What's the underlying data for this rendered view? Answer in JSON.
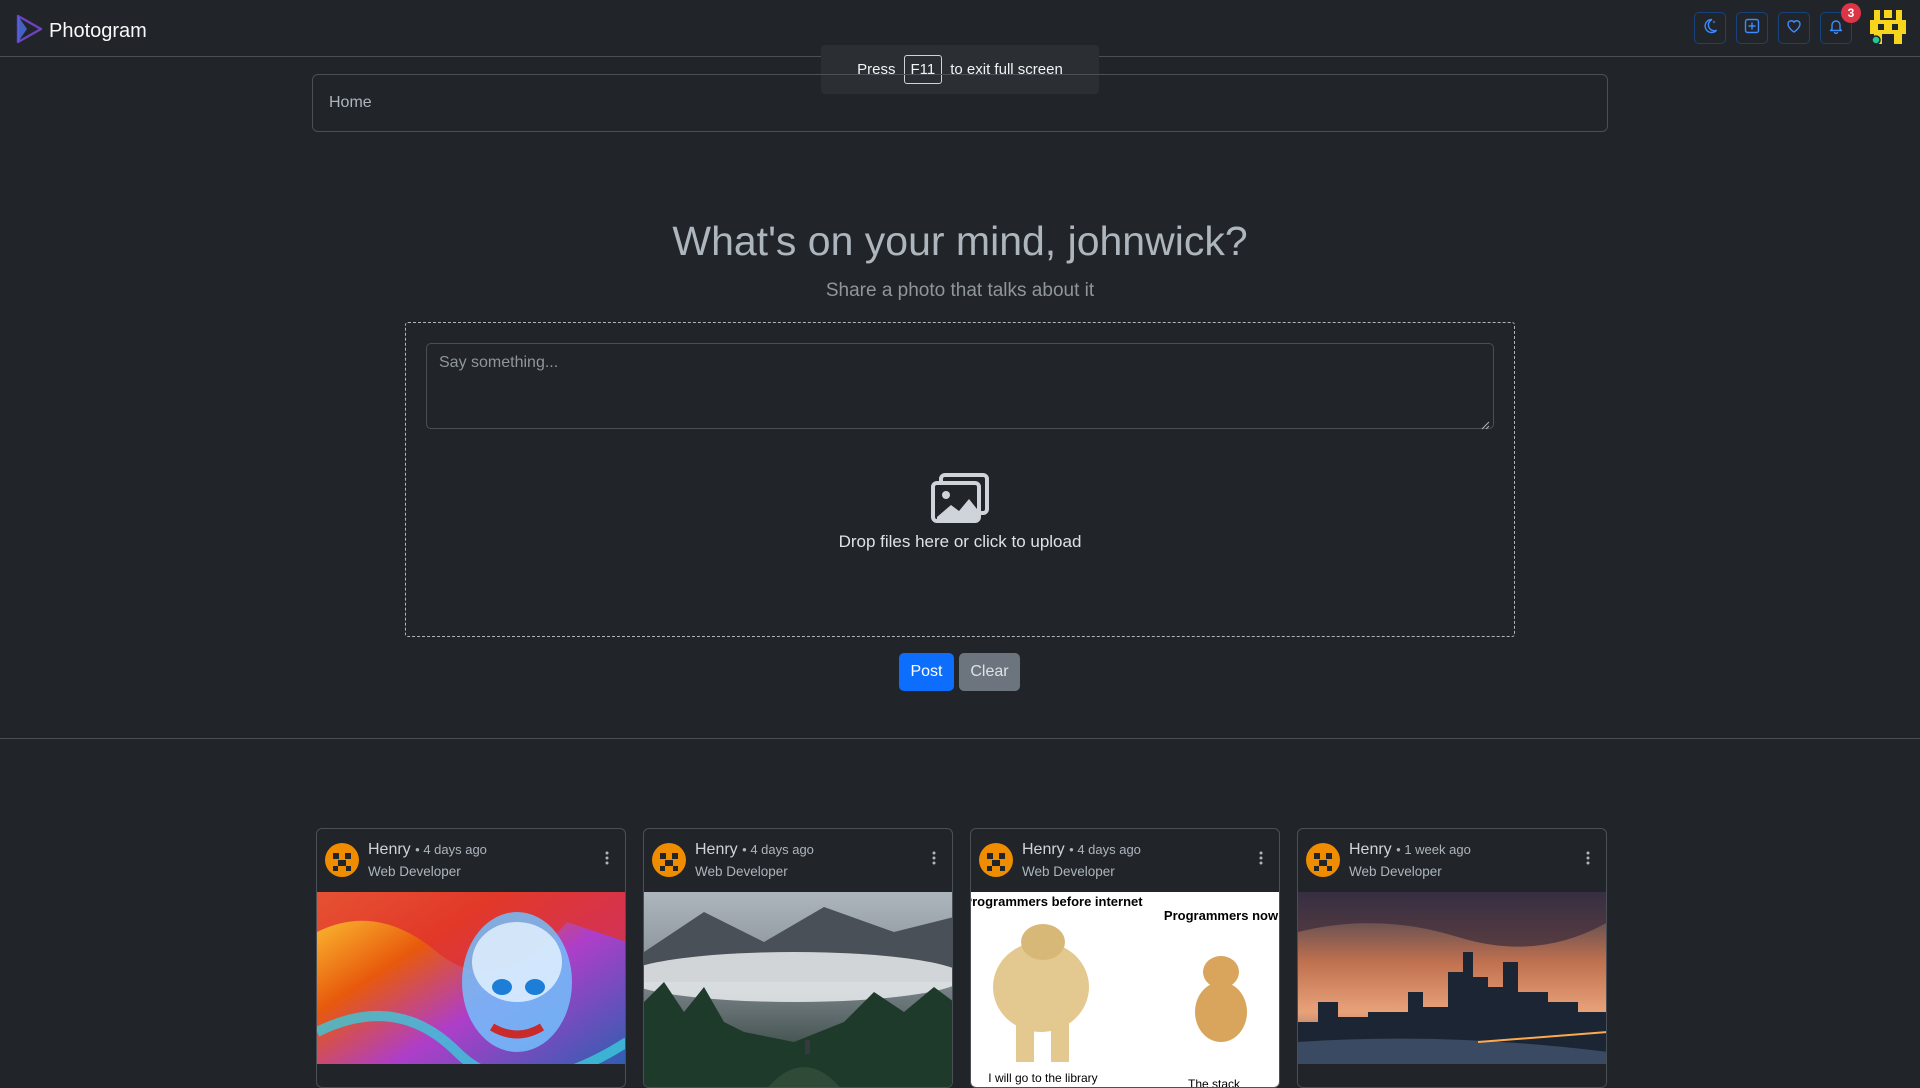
{
  "brand": {
    "name": "Photogram"
  },
  "nav": {
    "notification_count": "3"
  },
  "fullscreen_toast": {
    "before": "Press",
    "key": "F11",
    "after": "to exit full screen"
  },
  "breadcrumb": {
    "label": "Home"
  },
  "composer": {
    "headline": "What's on your mind, johnwick?",
    "subline": "Share a photo that talks about it",
    "textarea_placeholder": "Say something...",
    "upload_text": "Drop files here or click to upload",
    "post_label": "Post",
    "clear_label": "Clear"
  },
  "colors": {
    "primary": "#0d6efd",
    "secondary": "#6c757d",
    "danger": "#dc3545",
    "background": "#212529"
  },
  "feed": [
    {
      "author": "Henry",
      "time": "4 days ago",
      "role": "Web Developer",
      "image": "graffiti-einstein"
    },
    {
      "author": "Henry",
      "time": "4 days ago",
      "role": "Web Developer",
      "image": "foggy-mountain-forest"
    },
    {
      "author": "Henry",
      "time": "4 days ago",
      "role": "Web Developer",
      "image": "doge-meme",
      "meme": {
        "left_caption": "Programmers before internet",
        "right_caption": "Programmers now",
        "bottom_left": "I will go to the library",
        "bottom_right": "The stack"
      }
    },
    {
      "author": "Henry",
      "time": "1 week ago",
      "role": "Web Developer",
      "image": "city-skyline-sunset"
    }
  ]
}
